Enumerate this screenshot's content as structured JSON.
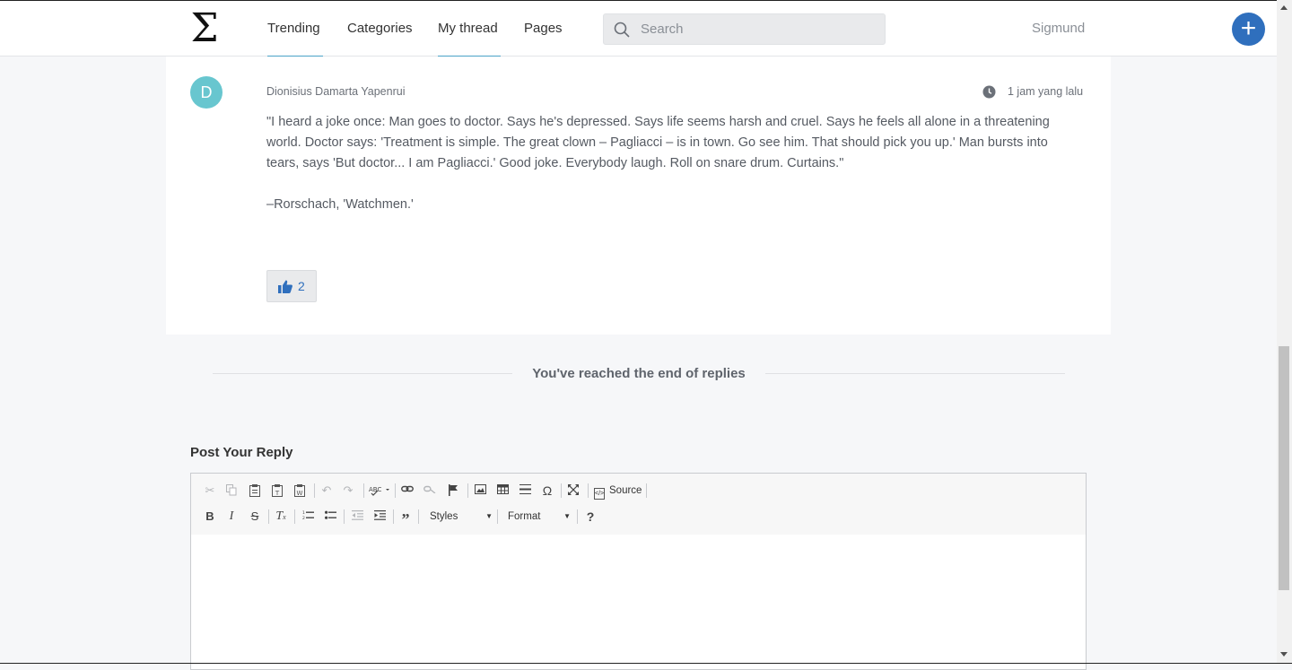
{
  "nav": {
    "logo": "Σ",
    "items": [
      {
        "label": "Trending"
      },
      {
        "label": "Categories"
      },
      {
        "label": "My thread"
      },
      {
        "label": "Pages"
      }
    ],
    "search_placeholder": "Search",
    "username": "Sigmund",
    "add_label": "+"
  },
  "post": {
    "avatar_letter": "D",
    "author": "Dionisius Damarta Yapenrui",
    "time": "1 jam yang lalu",
    "body": "\"I heard a joke once: Man goes to doctor. Says he's depressed. Says life seems harsh and cruel. Says he feels all alone in a threatening world. Doctor says: 'Treatment is simple. The great clown – Pagliacci – is in town. Go see him. That should pick you up.' Man bursts into tears, says 'But doctor... I am Pagliacci.' Good joke. Everybody laugh. Roll on snare drum. Curtains.\"",
    "signature": "–Rorschach, 'Watchmen.'",
    "likes": "2"
  },
  "end_message": "You've reached the end of replies",
  "reply": {
    "title": "Post Your Reply",
    "source_label": "Source",
    "styles_label": "Styles",
    "format_label": "Format"
  },
  "colors": {
    "accent": "#2f6fbd",
    "nav_active": "#4aa3c8",
    "avatar": "#68c6cf"
  }
}
